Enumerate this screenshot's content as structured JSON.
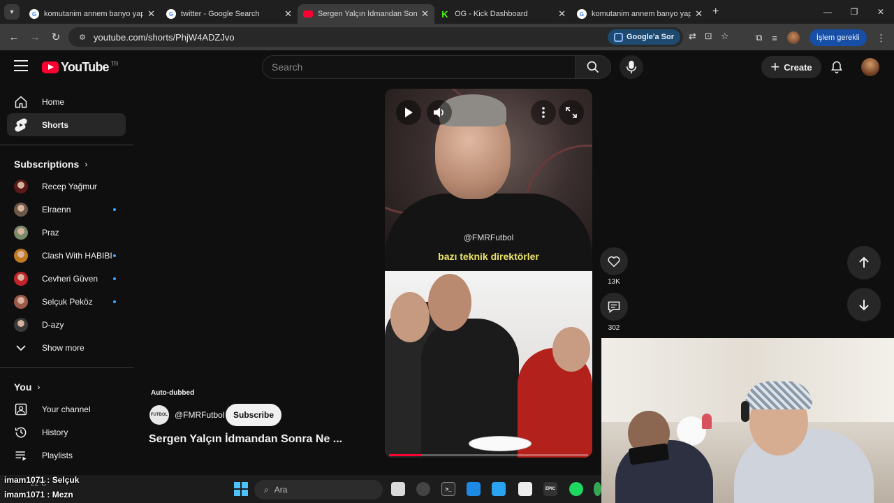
{
  "browser": {
    "tabs": [
      {
        "title": "komutanim annem banyo yapt...",
        "favicon": "google",
        "active": false
      },
      {
        "title": "twitter - Google Search",
        "favicon": "google",
        "active": false
      },
      {
        "title": "Sergen Yalçın İdmandan Sonra...",
        "favicon": "youtube",
        "active": true
      },
      {
        "title": "OG - Kick Dashboard",
        "favicon": "kick",
        "active": false
      },
      {
        "title": "komutanim annem banyo yapt...",
        "favicon": "google",
        "active": false
      }
    ],
    "url": "youtube.com/shorts/PhjW4ADZJvo",
    "lens_label": "Google'a Sor",
    "action_label": "İşlem gerekli"
  },
  "youtube": {
    "logo_text": "YouTube",
    "country": "TR",
    "search_placeholder": "Search",
    "create_label": "Create",
    "sidebar": {
      "primary": [
        {
          "label": "Home",
          "icon": "home-icon"
        },
        {
          "label": "Shorts",
          "icon": "shorts-icon",
          "active": true
        }
      ],
      "subscriptions_title": "Subscriptions",
      "subscriptions": [
        {
          "name": "Recep Yağmur",
          "color": "#5a1a1a",
          "new": false
        },
        {
          "name": "Elraenn",
          "color": "#6b5848",
          "new": true
        },
        {
          "name": "Praz",
          "color": "#7a8a6a",
          "new": false
        },
        {
          "name": "Clash With HABIBI",
          "color": "#c07a20",
          "new": true
        },
        {
          "name": "Cevheri Güven",
          "color": "#c0242a",
          "new": true
        },
        {
          "name": "Selçuk Peköz",
          "color": "#9a5a4a",
          "new": true
        },
        {
          "name": "D-azy",
          "color": "#3a3a3a",
          "new": false
        }
      ],
      "show_more": "Show more",
      "you_title": "You",
      "you_items": [
        {
          "label": "Your channel",
          "icon": "your-channel-icon"
        },
        {
          "label": "History",
          "icon": "history-icon"
        },
        {
          "label": "Playlists",
          "icon": "playlists-icon"
        }
      ]
    },
    "short": {
      "watermark": "@FMRFutbol",
      "caption": "bazı teknik direktörler",
      "progress": 0.16,
      "auto_dubbed": "Auto-dubbed",
      "channel": "@FMRFutbol",
      "channel_avatar_text": "FUTBOL",
      "subscribe_label": "Subscribe",
      "title": "Sergen Yalçın İdmandan Sonra Ne ...",
      "likes": "13K",
      "comments": "302"
    }
  },
  "stream_overlay": {
    "chat": [
      {
        "text": "imam1071 : Selçuk"
      },
      {
        "text": "imam1071 : Mezn"
      }
    ]
  },
  "taskbar": {
    "search_placeholder": "Ara",
    "weather": "22°C"
  }
}
